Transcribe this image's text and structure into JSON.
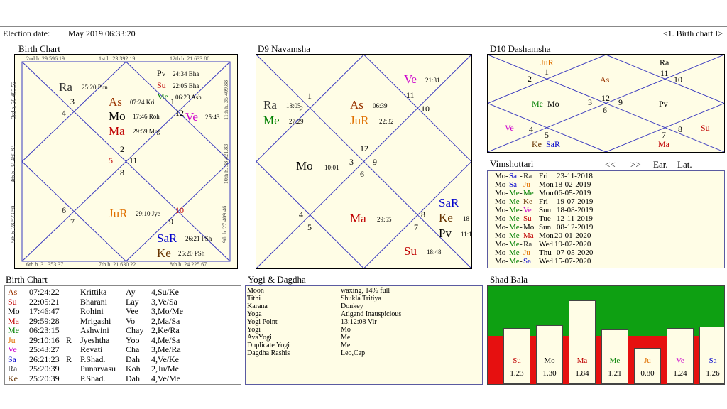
{
  "topbar": {
    "label": "Election date:",
    "date": "May 2019  06:33:20",
    "nav": "<1. Birth chart I>"
  },
  "colors": {
    "Su": "#c00000",
    "Mo": "#000000",
    "Ma": "#c00000",
    "Me": "#008000",
    "Ju": "#e07000",
    "Ve": "#cc00cc",
    "Sa": "#0000cc",
    "Ra": "#333333",
    "Ke": "#663300",
    "As": "#993300",
    "Pv": "#000000"
  },
  "birth_chart": {
    "title": "Birth Chart",
    "edges": {
      "top1": "2nd h. 29 596.19",
      "top2": "1st h. 23 392.19",
      "top3": "12th h. 21 633.80",
      "bot1": "6th h. 31 353.37",
      "bot2": "7th h. 21 630.22",
      "bot3": "8th h. 24 225.67",
      "left1": "3rd h. 28 483.52",
      "left2": "4th h. 32 460.83",
      "left3": "5th h. 28 523.50",
      "right1": "11th h. 35 409.88",
      "right2": "10th h. 38 421.83",
      "right3": "9th h. 27 409.46"
    },
    "numbers": {
      "n1": "1",
      "n2": "2",
      "n3": "3",
      "n4": "4",
      "n5": "5",
      "n6": "6",
      "n7": "7",
      "n8": "8",
      "n9": "9",
      "n10": "10",
      "n11": "11",
      "n12": "12"
    },
    "planets": {
      "ra": "Ra",
      "ra_deg": "25:20 Pun",
      "as": "As",
      "as_deg": "07:24 Kri",
      "mo": "Mo",
      "mo_deg": "17:46 Roh",
      "ma": "Ma",
      "ma_deg": "29:59 Mrg",
      "pv": "Pv",
      "pv_deg": "24:34 Bha",
      "su": "Su",
      "su_deg": "22:05 Bha",
      "me": "Me",
      "me_deg": "06:23 Ash",
      "ve": "Ve",
      "ve_deg": "25:43",
      "ju": "JuR",
      "ju_deg": "29:10 Jye",
      "sa": "SaR",
      "sa_deg": "26:21 PSh",
      "ke": "Ke",
      "ke_deg": "25:20 PSh"
    }
  },
  "d9": {
    "title": "D9 Navamsha",
    "numbers": {
      "n1": "1",
      "n2": "2",
      "n3": "3",
      "n4": "4",
      "n5": "5",
      "n6": "6",
      "n7": "7",
      "n8": "8",
      "n9": "9",
      "n10": "10",
      "n11": "11",
      "n12": "12"
    },
    "planets": {
      "ve": "Ve",
      "ve_deg": "21:31",
      "ra": "Ra",
      "ra_deg": "18:05",
      "me": "Me",
      "me_deg": "27:29",
      "as": "As",
      "as_deg": "06:39",
      "ju": "JuR",
      "ju_deg": "22:32",
      "mo": "Mo",
      "mo_deg": "10:01",
      "ma": "Ma",
      "ma_deg": "29:55",
      "sa": "SaR",
      "ke": "Ke",
      "ke_deg": "18",
      "pv": "Pv",
      "pv_deg": "11:1",
      "su": "Su",
      "su_deg": "18:48"
    }
  },
  "d10": {
    "title": "D10 Dashamsha",
    "numbers": {
      "n1": "1",
      "n2": "2",
      "n3": "3",
      "n4": "4",
      "n5": "5",
      "n6": "6",
      "n7": "7",
      "n8": "8",
      "n9": "9",
      "n10": "10",
      "n11": "11",
      "n12": "12"
    },
    "planets": {
      "ju": "JuR",
      "ra": "Ra",
      "as": "As",
      "me": "Me",
      "mo": "Mo",
      "pv": "Pv",
      "ve": "Ve",
      "su": "Su",
      "ke": "Ke",
      "sa": "SaR",
      "ma": "Ma"
    }
  },
  "vimshottari": {
    "title": "Vimshottari",
    "prev": "<<",
    "next": ">>",
    "ear": "Ear.",
    "lat": "Lat.",
    "rows": [
      {
        "a": "Mo",
        "b": "Sa",
        "c": "Ra",
        "day": "Fri",
        "date": "23-11-2018"
      },
      {
        "a": "Mo",
        "b": "Sa",
        "c": "Ju",
        "day": "Mon",
        "date": "18-02-2019"
      },
      {
        "a": "Mo",
        "b": "Me",
        "c": "Me",
        "day": "Mon",
        "date": "06-05-2019"
      },
      {
        "a": "Mo",
        "b": "Me",
        "c": "Ke",
        "day": "Fri",
        "date": "19-07-2019"
      },
      {
        "a": "Mo",
        "b": "Me",
        "c": "Ve",
        "day": "Sun",
        "date": "18-08-2019"
      },
      {
        "a": "Mo",
        "b": "Me",
        "c": "Su",
        "day": "Tue",
        "date": "12-11-2019"
      },
      {
        "a": "Mo",
        "b": "Me",
        "c": "Mo",
        "day": "Sun",
        "date": "08-12-2019"
      },
      {
        "a": "Mo",
        "b": "Me",
        "c": "Ma",
        "day": "Mon",
        "date": "20-01-2020"
      },
      {
        "a": "Mo",
        "b": "Me",
        "c": "Ra",
        "day": "Wed",
        "date": "19-02-2020"
      },
      {
        "a": "Mo",
        "b": "Me",
        "c": "Ju",
        "day": "Thu",
        "date": "07-05-2020"
      },
      {
        "a": "Mo",
        "b": "Me",
        "c": "Sa",
        "day": "Wed",
        "date": "15-07-2020"
      }
    ]
  },
  "birth_table": {
    "title": "Birth Chart",
    "rows": [
      {
        "p": "As",
        "deg": "07:24:22",
        "r": "",
        "nak": "Krittika",
        "syl": "Ay",
        "pada": "4,Su/Ke"
      },
      {
        "p": "Su",
        "deg": "22:05:21",
        "r": "",
        "nak": "Bharani",
        "syl": "Lay",
        "pada": "3,Ve/Sa"
      },
      {
        "p": "Mo",
        "deg": "17:46:47",
        "r": "",
        "nak": "Rohini",
        "syl": "Vee",
        "pada": "3,Mo/Me"
      },
      {
        "p": "Ma",
        "deg": "29:59:28",
        "r": "",
        "nak": "Mrigashi",
        "syl": "Vo",
        "pada": "2,Ma/Sa"
      },
      {
        "p": "Me",
        "deg": "06:23:15",
        "r": "",
        "nak": "Ashwini",
        "syl": "Chay",
        "pada": "2,Ke/Ra"
      },
      {
        "p": "Ju",
        "deg": "29:10:16",
        "r": "R",
        "nak": "Jyeshtha",
        "syl": "Yoo",
        "pada": "4,Me/Sa"
      },
      {
        "p": "Ve",
        "deg": "25:43:27",
        "r": "",
        "nak": "Revati",
        "syl": "Cha",
        "pada": "3,Me/Ra"
      },
      {
        "p": "Sa",
        "deg": "26:21:23",
        "r": "R",
        "nak": "P.Shad.",
        "syl": "Dah",
        "pada": "4,Ve/Ke"
      },
      {
        "p": "Ra",
        "deg": "25:20:39",
        "r": "",
        "nak": "Punarvasu",
        "syl": "Koh",
        "pada": "2,Ju/Me"
      },
      {
        "p": "Ke",
        "deg": "25:20:39",
        "r": "",
        "nak": "P.Shad.",
        "syl": "Dah",
        "pada": "4,Ve/Me"
      }
    ]
  },
  "yogi": {
    "title": "Yogi & Dagdha",
    "rows": [
      {
        "k": "Moon",
        "v": "waxing, 14% full"
      },
      {
        "k": "Tithi",
        "v": "Shukla  Tritiya"
      },
      {
        "k": "Karana",
        "v": "Donkey"
      },
      {
        "k": "Yoga",
        "v": "Atigand Inauspicious"
      },
      {
        "k": "Yogi Point",
        "v": "13:12:08 Vir"
      },
      {
        "k": "Yogi",
        "v": "Mo"
      },
      {
        "k": "AvaYogi",
        "v": "Me"
      },
      {
        "k": "Duplicate Yogi",
        "v": "Me"
      },
      {
        "k": "Dagdha Rashis",
        "v": "Leo,Cap"
      }
    ]
  },
  "shad_bala": {
    "title": "Shad Bala",
    "bars": [
      {
        "p": "Su",
        "v": "1.23",
        "h": 1.23
      },
      {
        "p": "Mo",
        "v": "1.30",
        "h": 1.3
      },
      {
        "p": "Ma",
        "v": "1.84",
        "h": 1.84
      },
      {
        "p": "Me",
        "v": "1.21",
        "h": 1.21
      },
      {
        "p": "Ju",
        "v": "0.80",
        "h": 0.8
      },
      {
        "p": "Ve",
        "v": "1.24",
        "h": 1.24
      },
      {
        "p": "Sa",
        "v": "1.26",
        "h": 1.26
      }
    ]
  }
}
